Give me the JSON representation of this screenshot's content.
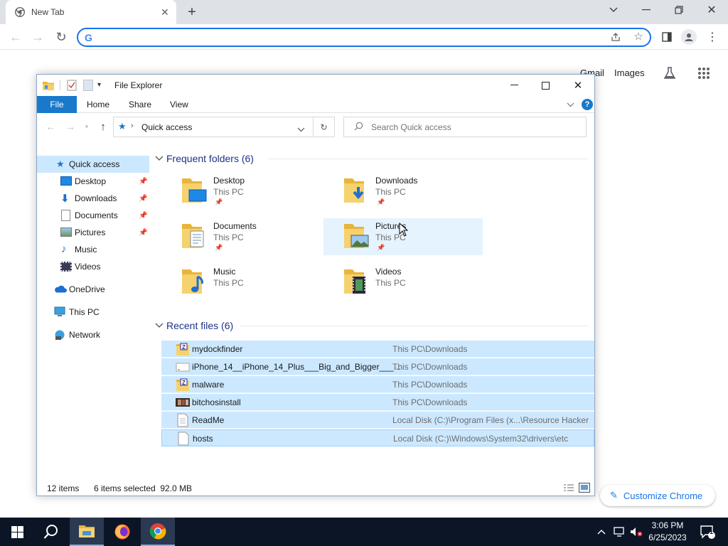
{
  "chrome": {
    "tab_title": "New Tab",
    "omnibox_value": "",
    "newtab_links": {
      "gmail": "Gmail",
      "images": "Images"
    },
    "customize_label": "Customize Chrome"
  },
  "explorer": {
    "title": "File Explorer",
    "ribbon_tabs": {
      "file": "File",
      "home": "Home",
      "share": "Share",
      "view": "View"
    },
    "address": "Quick access",
    "search_placeholder": "Search Quick access",
    "nav": {
      "quick_access": "Quick access",
      "desktop": "Desktop",
      "downloads": "Downloads",
      "documents": "Documents",
      "pictures": "Pictures",
      "music": "Music",
      "videos": "Videos",
      "onedrive": "OneDrive",
      "this_pc": "This PC",
      "network": "Network"
    },
    "frequent": {
      "heading": "Frequent folders (6)",
      "folders": [
        {
          "name": "Desktop",
          "location": "This PC",
          "pinned": true
        },
        {
          "name": "Downloads",
          "location": "This PC",
          "pinned": true
        },
        {
          "name": "Documents",
          "location": "This PC",
          "pinned": true
        },
        {
          "name": "Pictures",
          "location": "This PC",
          "pinned": true
        },
        {
          "name": "Music",
          "location": "This PC",
          "pinned": false
        },
        {
          "name": "Videos",
          "location": "This PC",
          "pinned": false
        }
      ]
    },
    "recent": {
      "heading": "Recent files (6)",
      "files": [
        {
          "name": "mydockfinder",
          "location": "This PC\\Downloads",
          "icon": "zip-folder-icon"
        },
        {
          "name": "iPhone_14__iPhone_14_Plus___Big_and_Bigger___...",
          "location": "This PC\\Downloads",
          "icon": "web-file-icon"
        },
        {
          "name": "malware",
          "location": "This PC\\Downloads",
          "icon": "zip-folder-icon"
        },
        {
          "name": "bitchosinstall",
          "location": "This PC\\Downloads",
          "icon": "installer-image-icon"
        },
        {
          "name": "ReadMe",
          "location": "Local Disk (C:)\\Program Files (x...\\Resource Hacker",
          "icon": "text-file-icon"
        },
        {
          "name": "hosts",
          "location": "Local Disk (C:)\\Windows\\System32\\drivers\\etc",
          "icon": "blank-file-icon"
        }
      ]
    },
    "status": {
      "items": "12 items",
      "selected": "6 items selected  92.0 MB"
    }
  },
  "taskbar": {
    "time": "3:06 PM",
    "date": "6/25/2023",
    "notification_count": "1"
  },
  "colors": {
    "accent": "#1a73e8",
    "selection": "#cce8ff",
    "file_tab": "#1979ca",
    "taskbar": "#0b1526"
  }
}
